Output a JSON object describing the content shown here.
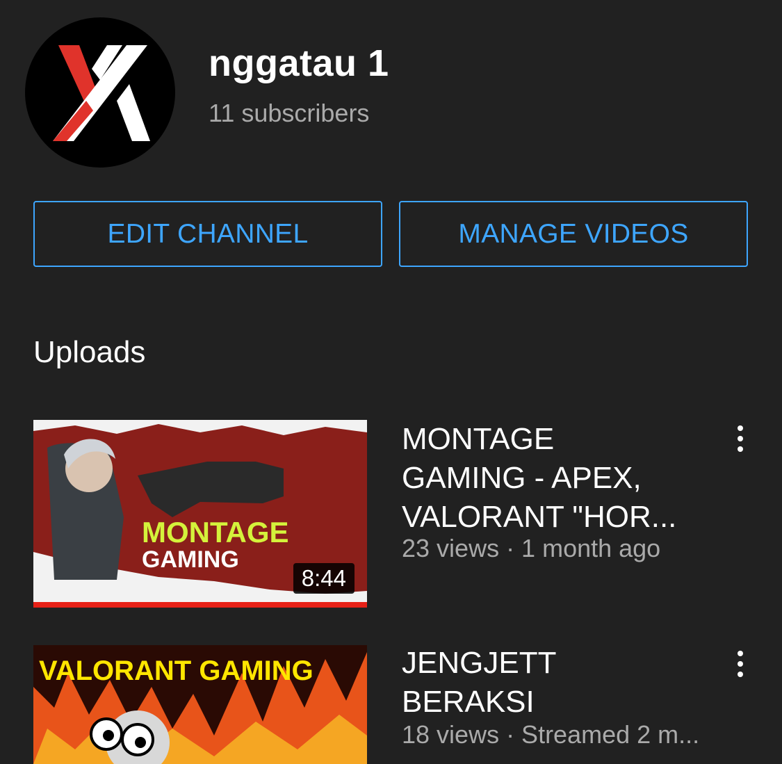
{
  "channel": {
    "name": "nggatau 1",
    "subscribers": "11 subscribers",
    "avatar_icon": "x-logo-icon"
  },
  "buttons": {
    "edit_channel": "EDIT CHANNEL",
    "manage_videos": "MANAGE VIDEOS"
  },
  "uploads": {
    "title": "Uploads",
    "videos": [
      {
        "title_line1": "MONTAGE",
        "title_line2": "GAMING - APEX,",
        "title_line3": "VALORANT \"HOR...",
        "meta": "23 views · 1 month ago",
        "duration": "8:44",
        "thumb_text_1": "MONTAGE",
        "thumb_text_2": "GAMING",
        "watched_fraction": 1.0
      },
      {
        "title_line1": "JENGJETT",
        "title_line2": "BERAKSI",
        "meta": "18 views · Streamed 2 m...",
        "thumb_text_1": "VALORANT GAMING"
      }
    ]
  },
  "colors": {
    "background": "#212121",
    "accent": "#3ea6ff",
    "progress": "#e62117",
    "thumb_text_green": "#d4f23b"
  }
}
